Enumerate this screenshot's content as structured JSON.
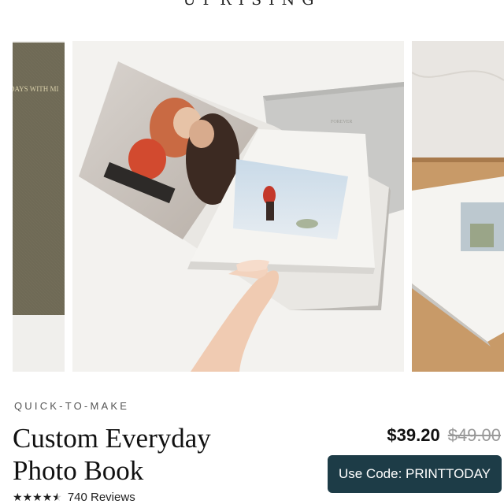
{
  "header": {
    "brand_partial": "UPRISING"
  },
  "carousel": {
    "left_cover_text": "DAYS WITH MI",
    "main_book_spine_text": "FOREVER"
  },
  "product": {
    "eyebrow": "QUICK-TO-MAKE",
    "title": "Custom Everyday Photo Book",
    "rating_value": 4.5,
    "rating_max": 5,
    "reviews_label": "740 Reviews",
    "price": "$39.20",
    "original_price": "$49.00",
    "promo_label": "Use Code: PRINTTODAY"
  },
  "colors": {
    "promo_bg": "#1d3c47",
    "cover_olive": "#6f6a56",
    "cover_grey": "#c9c9c7"
  },
  "icons": [
    "star-icon",
    "star-half-icon"
  ]
}
